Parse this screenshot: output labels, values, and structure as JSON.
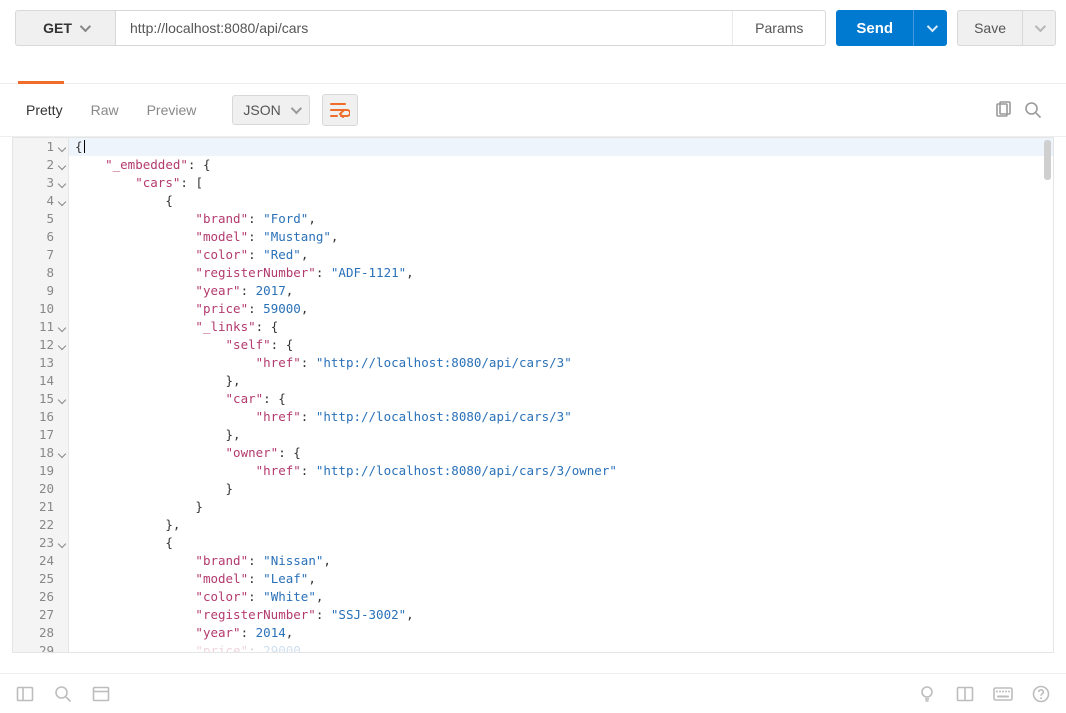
{
  "request": {
    "method": "GET",
    "url": "http://localhost:8080/api/cars",
    "params_label": "Params",
    "send_label": "Send",
    "save_label": "Save"
  },
  "response_toolbar": {
    "views": {
      "pretty": "Pretty",
      "raw": "Raw",
      "preview": "Preview"
    },
    "format_label": "JSON"
  },
  "code_lines": [
    {
      "n": 1,
      "fold": true,
      "hl": true,
      "raw": "{"
    },
    {
      "n": 2,
      "fold": true,
      "raw": "    \"_embedded\": {"
    },
    {
      "n": 3,
      "fold": true,
      "raw": "        \"cars\": ["
    },
    {
      "n": 4,
      "fold": true,
      "raw": "            {"
    },
    {
      "n": 5,
      "fold": false,
      "raw": "                \"brand\": \"Ford\","
    },
    {
      "n": 6,
      "fold": false,
      "raw": "                \"model\": \"Mustang\","
    },
    {
      "n": 7,
      "fold": false,
      "raw": "                \"color\": \"Red\","
    },
    {
      "n": 8,
      "fold": false,
      "raw": "                \"registerNumber\": \"ADF-1121\","
    },
    {
      "n": 9,
      "fold": false,
      "raw": "                \"year\": 2017,"
    },
    {
      "n": 10,
      "fold": false,
      "raw": "                \"price\": 59000,"
    },
    {
      "n": 11,
      "fold": true,
      "raw": "                \"_links\": {"
    },
    {
      "n": 12,
      "fold": true,
      "raw": "                    \"self\": {"
    },
    {
      "n": 13,
      "fold": false,
      "raw": "                        \"href\": \"http://localhost:8080/api/cars/3\""
    },
    {
      "n": 14,
      "fold": false,
      "raw": "                    },"
    },
    {
      "n": 15,
      "fold": true,
      "raw": "                    \"car\": {"
    },
    {
      "n": 16,
      "fold": false,
      "raw": "                        \"href\": \"http://localhost:8080/api/cars/3\""
    },
    {
      "n": 17,
      "fold": false,
      "raw": "                    },"
    },
    {
      "n": 18,
      "fold": true,
      "raw": "                    \"owner\": {"
    },
    {
      "n": 19,
      "fold": false,
      "raw": "                        \"href\": \"http://localhost:8080/api/cars/3/owner\""
    },
    {
      "n": 20,
      "fold": false,
      "raw": "                    }"
    },
    {
      "n": 21,
      "fold": false,
      "raw": "                }"
    },
    {
      "n": 22,
      "fold": false,
      "raw": "            },"
    },
    {
      "n": 23,
      "fold": true,
      "raw": "            {"
    },
    {
      "n": 24,
      "fold": false,
      "raw": "                \"brand\": \"Nissan\","
    },
    {
      "n": 25,
      "fold": false,
      "raw": "                \"model\": \"Leaf\","
    },
    {
      "n": 26,
      "fold": false,
      "raw": "                \"color\": \"White\","
    },
    {
      "n": 27,
      "fold": false,
      "raw": "                \"registerNumber\": \"SSJ-3002\","
    },
    {
      "n": 28,
      "fold": false,
      "raw": "                \"year\": 2014,"
    },
    {
      "n": 29,
      "fold": false,
      "fade": true,
      "raw": "                \"price\": 29000,"
    }
  ]
}
